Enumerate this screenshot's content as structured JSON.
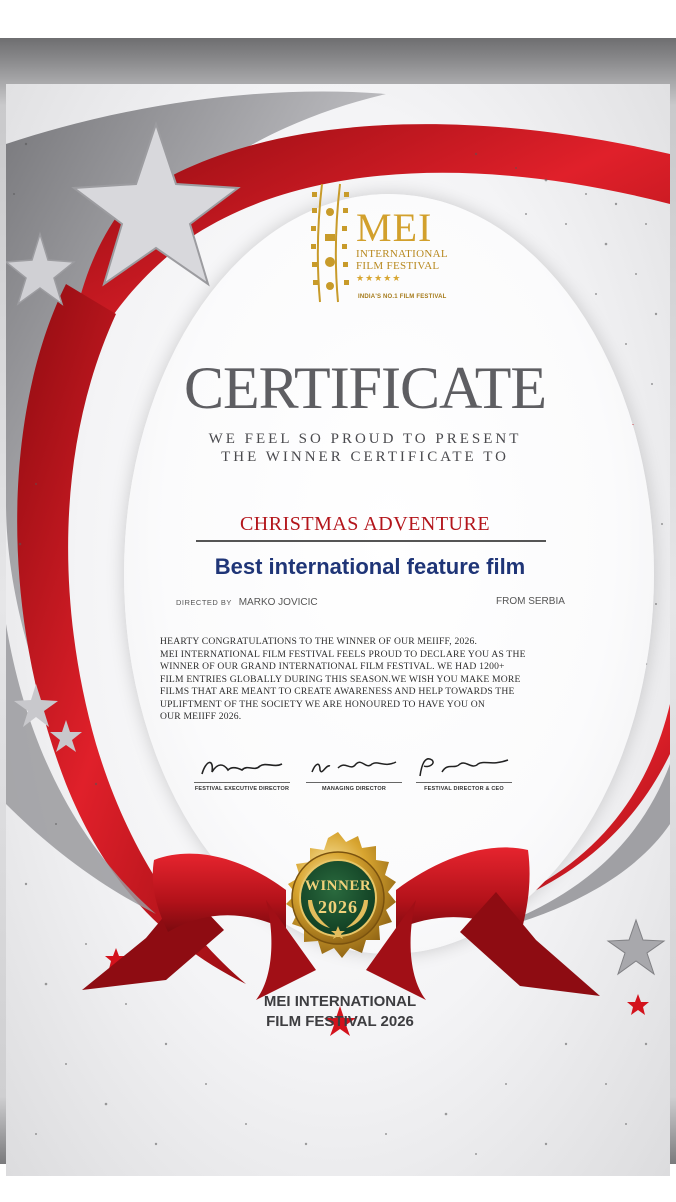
{
  "logo": {
    "name": "MEI",
    "line1": "INTERNATIONAL",
    "line2": "FILM FESTIVAL",
    "stars": "★★★★★",
    "tagline": "INDIA'S NO.1 FILM FESTIVAL"
  },
  "certificate": {
    "title": "CERTIFICATE",
    "present_line1": "WE FEEL SO PROUD TO PRESENT",
    "present_line2": "THE WINNER CERTIFICATE TO",
    "film": "CHRISTMAS ADVENTURE",
    "award": "Best international feature film",
    "directed_label": "DIRECTED BY",
    "director": "MARKO JOVICIC",
    "from": "FROM SERBIA",
    "body": [
      "HEARTY CONGRATULATIONS TO THE WINNER OF OUR MEIIFF, 2026.",
      "MEI INTERNATIONAL FILM FESTIVAL FEELS PROUD TO DECLARE YOU AS THE",
      "WINNER OF OUR GRAND INTERNATIONAL FILM FESTIVAL. WE HAD 1200+",
      "FILM ENTRIES GLOBALLY DURING THIS SEASON.WE WISH YOU MAKE MORE",
      "FILMS THAT ARE MEANT TO CREATE AWARENESS AND HELP TOWARDS THE",
      "UPLIFTMENT OF THE SOCIETY WE ARE HONOURED TO HAVE YOU ON",
      "OUR MEIIFF 2026."
    ]
  },
  "signatures": [
    {
      "label": "FESTIVAL EXECUTIVE DIRECTOR"
    },
    {
      "label": "MANAGING DIRECTOR"
    },
    {
      "label": "FESTIVAL DIRECTOR & CEO"
    }
  ],
  "seal": {
    "winner": "WINNER",
    "year": "2026"
  },
  "footer": {
    "line1": "MEI INTERNATIONAL",
    "line2": "FILM FESTIVAL 2026"
  },
  "colors": {
    "red": "#c8121b",
    "gold": "#d2a02c",
    "navy": "#1f3577",
    "green": "#164a2c"
  }
}
